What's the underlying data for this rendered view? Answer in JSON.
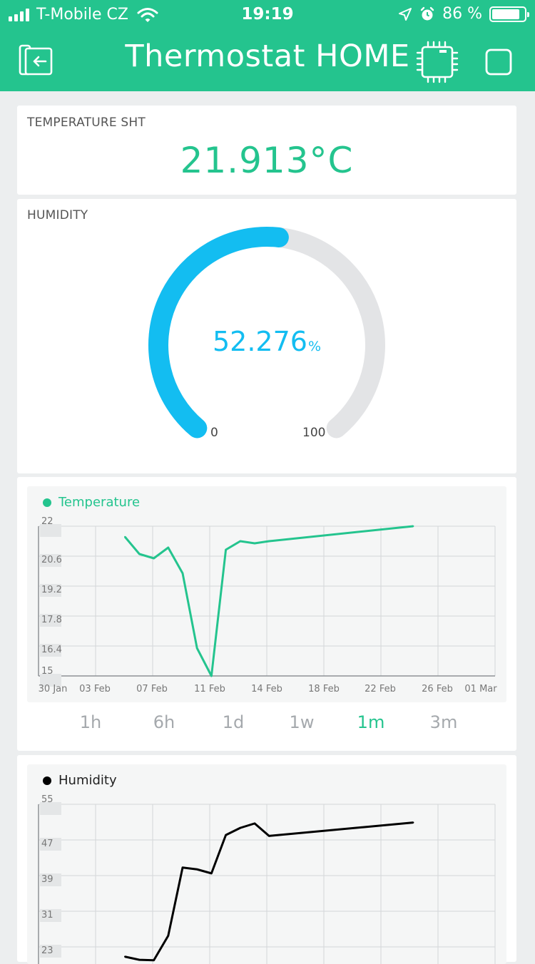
{
  "status_bar": {
    "carrier": "T-Mobile CZ",
    "time": "19:19",
    "battery": "86 %",
    "battery_level": 0.86
  },
  "header": {
    "title": "Thermostat HOME"
  },
  "temperature_widget": {
    "label": "TEMPERATURE SHT",
    "value": "21.913°C"
  },
  "humidity_widget": {
    "label": "HUMIDITY",
    "value": "52.276",
    "unit": "%",
    "min": "0",
    "max": "100",
    "level": 0.52276
  },
  "range_selector": {
    "options": [
      "1h",
      "6h",
      "1d",
      "1w",
      "1m",
      "3m"
    ],
    "active": "1m"
  },
  "colors": {
    "accent": "#24C48E",
    "gauge": "#13BDF1",
    "gauge_track": "#E3E4E6",
    "humidity_line": "#000000"
  },
  "chart_data": [
    {
      "type": "line",
      "series": [
        {
          "name": "Temperature",
          "color": "#24C48E",
          "x": [
            "2021-02-05",
            "2021-02-06",
            "2021-02-07",
            "2021-02-08",
            "2021-02-09",
            "2021-02-10",
            "2021-02-11",
            "2021-02-12",
            "2021-02-13",
            "2021-02-14",
            "2021-02-15",
            "2021-02-25"
          ],
          "values": [
            21.5,
            20.7,
            20.5,
            21.0,
            19.8,
            16.3,
            15.0,
            20.9,
            21.3,
            21.2,
            21.3,
            22.0
          ]
        }
      ],
      "x_tick_labels": [
        "30 Jan",
        "03 Feb",
        "07 Feb",
        "11 Feb",
        "14 Feb",
        "18 Feb",
        "22 Feb",
        "26 Feb",
        "01 Mar"
      ],
      "y_tick_labels": [
        "22",
        "20.6",
        "19.2",
        "17.8",
        "16.4",
        "15"
      ],
      "ylim": [
        15,
        22
      ],
      "grid": true
    },
    {
      "type": "line",
      "series": [
        {
          "name": "Humidity",
          "color": "#000000",
          "x": [
            "2021-02-05",
            "2021-02-06",
            "2021-02-07",
            "2021-02-08",
            "2021-02-09",
            "2021-02-10",
            "2021-02-11",
            "2021-02-12",
            "2021-02-13",
            "2021-02-14",
            "2021-02-15",
            "2021-02-25"
          ],
          "values": [
            20.8,
            20.1,
            20.0,
            25.5,
            40.8,
            40.4,
            39.5,
            48.1,
            49.7,
            50.7,
            47.9,
            50.9
          ]
        }
      ],
      "x_tick_labels": [],
      "y_tick_labels": [
        "55",
        "47",
        "39",
        "31",
        "23"
      ],
      "ylim": [
        15,
        55
      ],
      "grid": true
    }
  ]
}
